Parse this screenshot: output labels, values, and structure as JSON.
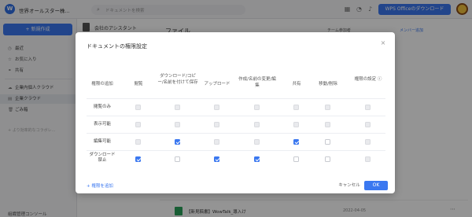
{
  "topbar": {
    "org_name": "世界オールスター株...",
    "search_placeholder": "ドキュメントを検索",
    "wps_button": "WPS Officeのダウンロード"
  },
  "sidebar": {
    "new_button": "+ 新規作成",
    "items": [
      {
        "label": "最近",
        "icon": "clock-icon"
      },
      {
        "label": "お気に入り",
        "icon": "star-icon"
      },
      {
        "label": "共有",
        "icon": "share-icon"
      },
      {
        "label": "企業内個人クラウド",
        "icon": "cloud-icon"
      },
      {
        "label": "企業クラウド",
        "icon": "building-icon"
      },
      {
        "label": "ごみ箱",
        "icon": "trash-icon"
      }
    ],
    "more": "+ より効率的なコラボレ...",
    "bottom": "組織管理コンソール"
  },
  "main": {
    "workspace_label": "会社のアシスタント",
    "file_title": "ファイル",
    "member_tag": "チーム参加者",
    "member_link": "メンバー追加",
    "file_row_name": "【新見稿書】WowTalk_導入け",
    "file_row_date": "2022-04-05"
  },
  "dialog": {
    "title": "ドキュメントの権限設定",
    "columns": [
      "権限の追加",
      "閲覧",
      "ダウンロード/コピー/名前を付けて保存",
      "アップロード",
      "作成/名前の変更/編集",
      "共有",
      "移動/削除",
      "権限の設定 ⓘ"
    ],
    "rows": [
      {
        "label": "閲覧のみ",
        "cells": [
          "disabled",
          "disabled",
          "disabled",
          "disabled",
          "disabled",
          "disabled",
          "disabled"
        ]
      },
      {
        "label": "表示可能",
        "cells": [
          "disabled",
          "disabled",
          "disabled",
          "disabled",
          "disabled",
          "disabled",
          "disabled"
        ]
      },
      {
        "label": "編集可能",
        "cells": [
          "disabled",
          "checked",
          "disabled",
          "disabled",
          "checked",
          "empty",
          "disabled"
        ]
      },
      {
        "label": "ダウンロード\n禁止",
        "cells": [
          "checked",
          "empty",
          "checked",
          "checked",
          "empty",
          "empty",
          "disabled"
        ]
      }
    ],
    "add_permission": "+ 権限を追加",
    "cancel": "キャンセル",
    "ok": "OK"
  },
  "colors": {
    "accent": "#3b78f0",
    "overlay": "rgba(0,0,0,0.42)"
  }
}
